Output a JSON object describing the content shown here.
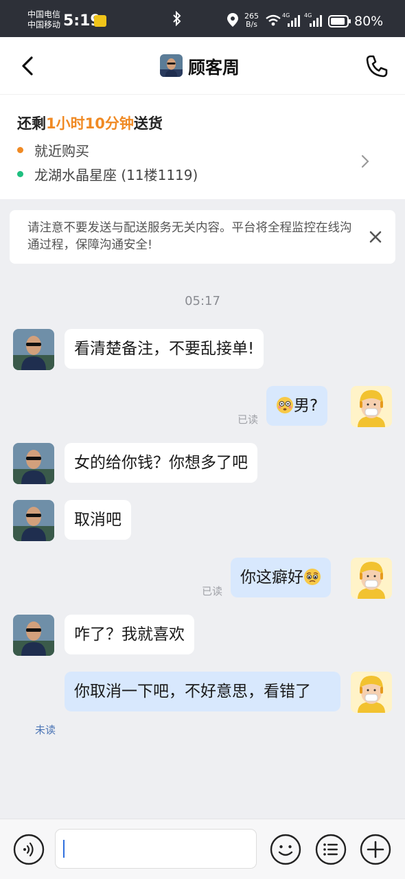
{
  "status_bar": {
    "carrier_1": "中国电信",
    "carrier_2": "中国移动",
    "time": "5:19",
    "net_speed_value": "265",
    "net_speed_unit": "B/s",
    "net_label_1": "4G",
    "net_label_2": "4G",
    "battery": "80%"
  },
  "header": {
    "title": "顾客周"
  },
  "order": {
    "countdown_prefix": "还剩",
    "countdown_value": "1小时10分钟",
    "countdown_suffix": "送货",
    "pickup": "就近购买",
    "address": "龙湖水晶星座 (11楼1119)"
  },
  "notice": {
    "text": "请注意不要发送与配送服务无关内容。平台将全程监控在线沟通过程，保障沟通安全!"
  },
  "chat": {
    "timestamp": "05:17",
    "messages": [
      {
        "side": "in",
        "text": "看清楚备注，不要乱接单!"
      },
      {
        "side": "out",
        "text": "男?",
        "emoji": "flushed-face",
        "status": "已读"
      },
      {
        "side": "in",
        "text": "女的给你钱？你想多了吧"
      },
      {
        "side": "in",
        "text": "取消吧"
      },
      {
        "side": "out",
        "text": "你这癖好",
        "emoji": "pleading-face",
        "status": "已读"
      },
      {
        "side": "in",
        "text": "咋了？我就喜欢"
      },
      {
        "side": "out",
        "text": "你取消一下吧，不好意思，看错了",
        "status": "未读"
      }
    ]
  },
  "input": {
    "placeholder": ""
  },
  "colors": {
    "accent_orange": "#f08a24",
    "outgoing_bubble": "#d8e8fd",
    "unread_blue": "#4a74b5",
    "status_bar_bg": "#2d3038"
  }
}
